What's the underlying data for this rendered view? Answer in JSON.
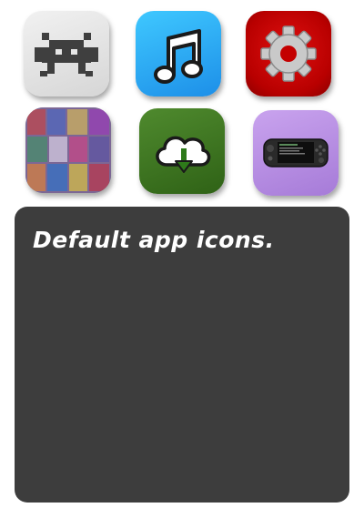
{
  "apps": [
    {
      "name": "retroarch",
      "icon": "retroarch-invader-icon",
      "color": "#e0e0e0"
    },
    {
      "name": "music",
      "icon": "music-note-icon",
      "color": "#2aa8f5"
    },
    {
      "name": "settings",
      "icon": "gear-icon",
      "color": "#d00000"
    },
    {
      "name": "games",
      "icon": "game-box-art-collage-icon",
      "color": "#6a5a7a"
    },
    {
      "name": "download",
      "icon": "cloud-download-icon",
      "color": "#3f7a22"
    },
    {
      "name": "handheld",
      "icon": "handheld-console-icon",
      "color": "#b58ae2"
    }
  ],
  "panel": {
    "text": "Default app icons.",
    "background": "#3d3d3d"
  }
}
